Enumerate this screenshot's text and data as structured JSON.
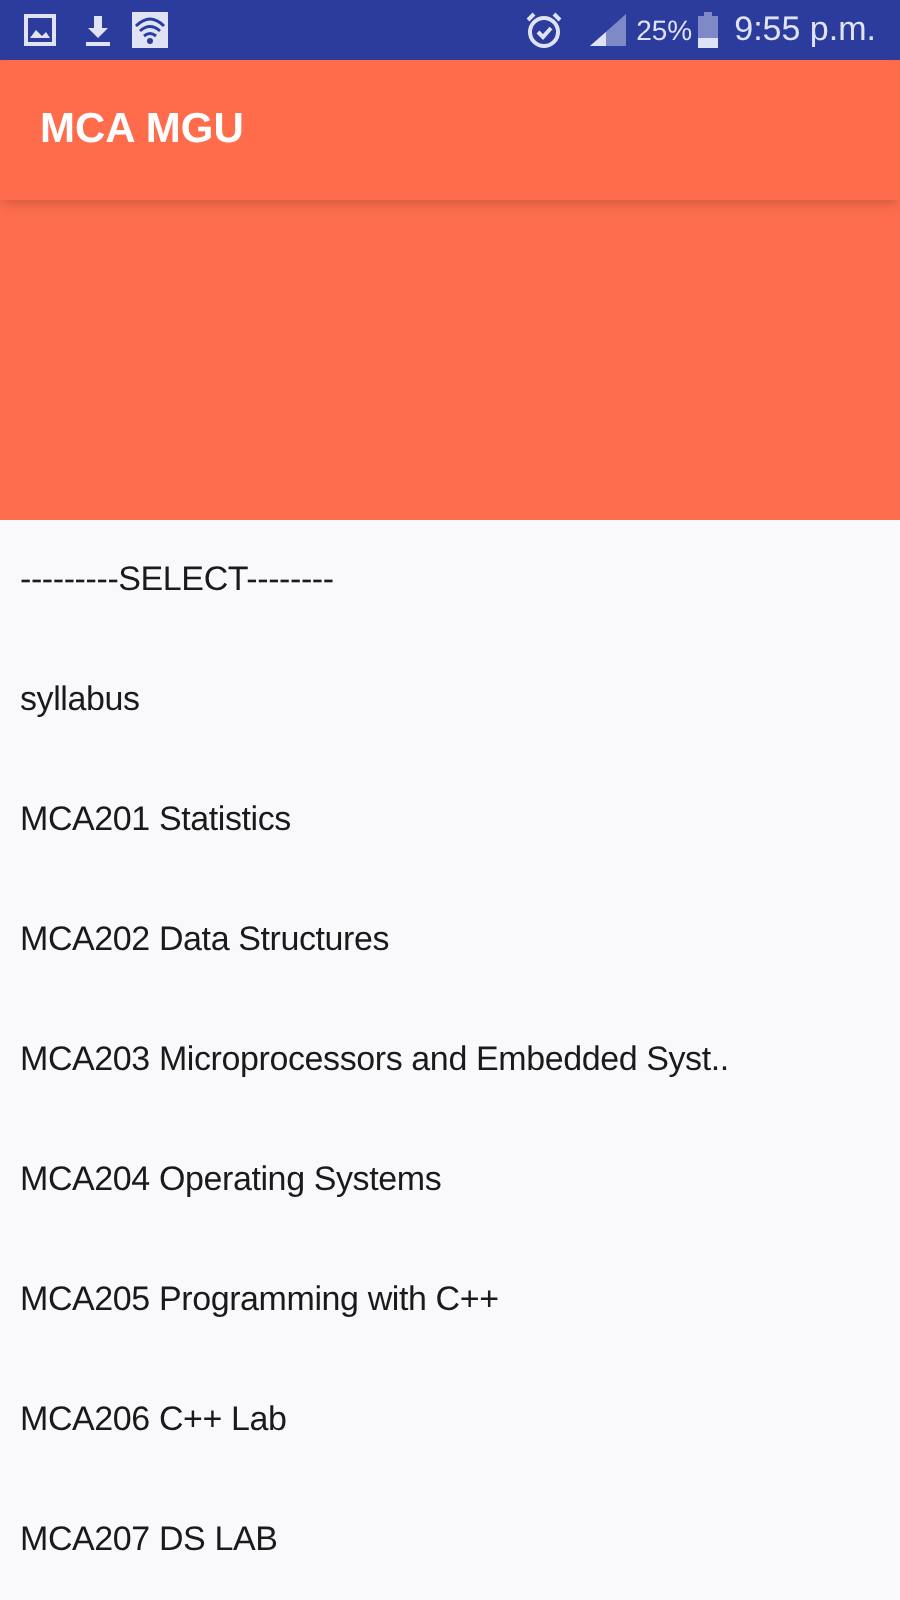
{
  "status_bar": {
    "battery": "25%",
    "time": "9:55 p.m."
  },
  "app_bar": {
    "title": "MCA MGU"
  },
  "dropdown": {
    "items": [
      {
        "label": "---------SELECT--------"
      },
      {
        "label": "syllabus"
      },
      {
        "label": "MCA201 Statistics"
      },
      {
        "label": "MCA202 Data Structures"
      },
      {
        "label": "MCA203 Microprocessors and Embedded Syst.."
      },
      {
        "label": "MCA204 Operating Systems"
      },
      {
        "label": "MCA205 Programming with C++"
      },
      {
        "label": "MCA206 C++ Lab"
      },
      {
        "label": "MCA207 DS LAB"
      }
    ]
  }
}
